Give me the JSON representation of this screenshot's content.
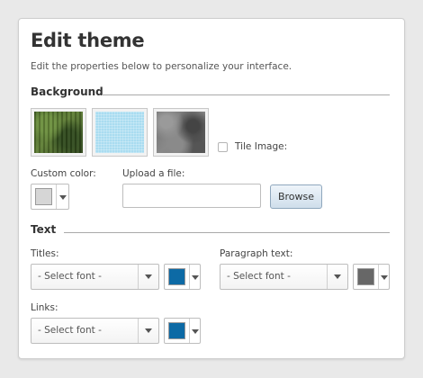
{
  "header": {
    "title": "Edit theme",
    "subtitle": "Edit the properties below to personalize your interface."
  },
  "background_section": {
    "heading": "Background",
    "swatches": [
      {
        "name": "green-texture"
      },
      {
        "name": "light-blue-texture"
      },
      {
        "name": "gray-stone-texture"
      }
    ],
    "tile_image_label": "Tile Image:",
    "tile_image_checked": false,
    "custom_color_label": "Custom color:",
    "custom_color_value": "#d6d6d6",
    "upload_label": "Upload a file:",
    "upload_value": "",
    "browse_label": "Browse"
  },
  "text_section": {
    "heading": "Text",
    "titles": {
      "label": "Titles:",
      "font": "- Select font -",
      "color": "#0d6aa5"
    },
    "paragraph": {
      "label": "Paragraph text:",
      "font": "- Select font -",
      "color": "#676767"
    },
    "links": {
      "label": "Links:",
      "font": "- Select font -",
      "color": "#0d6aa5"
    }
  }
}
